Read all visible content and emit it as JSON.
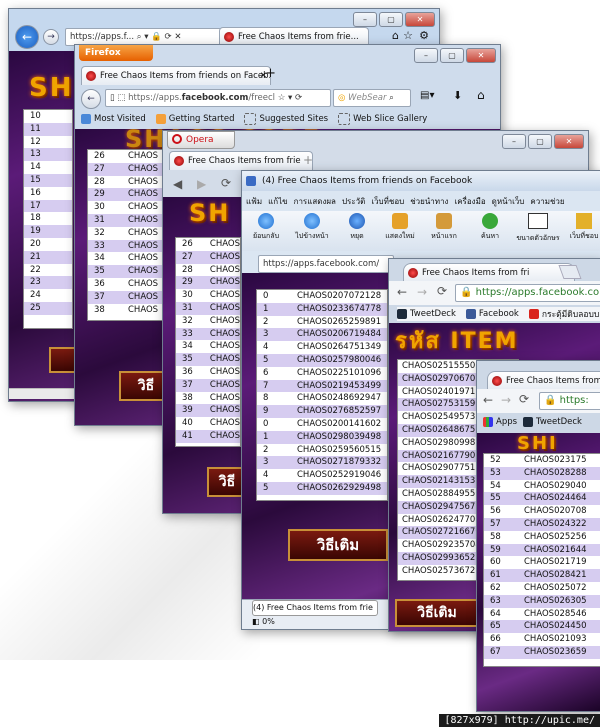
{
  "colors": {
    "row_alt": "#d6ccf0",
    "banner": "#f0a400",
    "ie_blue": "#1c6fd1",
    "firefox_orange": "#e66000",
    "opera_red": "#cc0f16"
  },
  "ie": {
    "url": "https://apps.f...",
    "tab_title": "Free Chaos Items from frie...",
    "rows": [
      [
        "10",
        ""
      ],
      [
        "11",
        ""
      ],
      [
        "12",
        ""
      ],
      [
        "13",
        ""
      ],
      [
        "14",
        ""
      ],
      [
        "15",
        ""
      ],
      [
        "16",
        ""
      ],
      [
        "17",
        ""
      ],
      [
        "18",
        ""
      ],
      [
        "19",
        ""
      ],
      [
        "20",
        ""
      ],
      [
        "21",
        ""
      ],
      [
        "22",
        ""
      ],
      [
        "23",
        ""
      ],
      [
        "24",
        ""
      ],
      [
        "25",
        ""
      ]
    ]
  },
  "firefox": {
    "app_button": "Firefox",
    "tab_title": "Free Chaos Items from friends on Faceb...",
    "new_tab": "+",
    "url_prefix": "https://apps.",
    "url_domain": "facebook.com",
    "url_suffix": "/freecl",
    "search_placeholder": "WebSear",
    "bookmarks": [
      "Most Visited",
      "Getting Started",
      "Suggested Sites",
      "Web Slice Gallery"
    ],
    "rows": [
      [
        "26",
        "CHAOS"
      ],
      [
        "27",
        "CHAOS"
      ],
      [
        "28",
        "CHAOS"
      ],
      [
        "29",
        "CHAOS"
      ],
      [
        "30",
        "CHAOS"
      ],
      [
        "31",
        "CHAOS"
      ],
      [
        "32",
        "CHAOS"
      ],
      [
        "33",
        "CHAOS"
      ],
      [
        "34",
        "CHAOS"
      ],
      [
        "35",
        "CHAOS"
      ],
      [
        "36",
        "CHAOS"
      ],
      [
        "37",
        "CHAOS"
      ],
      [
        "38",
        "CHAOS"
      ]
    ],
    "button": "วิธี"
  },
  "opera": {
    "app_button": "Opera",
    "tab_title": "Free Chaos Items from frie",
    "rows": [
      [
        "26",
        "CHAOS"
      ],
      [
        "27",
        "CHAOS"
      ],
      [
        "28",
        "CHAOS"
      ],
      [
        "29",
        "CHAOS"
      ],
      [
        "30",
        "CHAOS"
      ],
      [
        "31",
        "CHAOS"
      ],
      [
        "32",
        "CHAOS"
      ],
      [
        "33",
        "CHAOS"
      ],
      [
        "34",
        "CHAOS"
      ],
      [
        "35",
        "CHAOS"
      ],
      [
        "36",
        "CHAOS"
      ],
      [
        "37",
        "CHAOS"
      ],
      [
        "38",
        "CHAOS"
      ],
      [
        "39",
        "CHAOS"
      ],
      [
        "40",
        "CHAOS"
      ],
      [
        "41",
        "CHAOS"
      ]
    ],
    "button": "วิธี"
  },
  "thai": {
    "title": "(4) Free Chaos Items from friends on Facebook",
    "menu": [
      "แฟ้ม",
      "แก้ไข",
      "การแสดงผล",
      "ประวัติ",
      "เว็บที่ชอบ",
      "ช่วยนำทาง",
      "เครื่องมือ",
      "ดูหน้าเว็บ",
      "ความช่วย"
    ],
    "toolbar": [
      "ย้อนกลับ",
      "ไปข้างหน้า",
      "หยุด",
      "แสดงใหม่",
      "หน้าแรก",
      "ค้นหา",
      "ขนาดตัวอักษร",
      "เว็บที่ชอบ"
    ],
    "url": "https://apps.facebook.com/",
    "rows": [
      [
        "0",
        "CHAOS0207072128"
      ],
      [
        "1",
        "CHAOS0233674778"
      ],
      [
        "2",
        "CHAOS0265259891"
      ],
      [
        "3",
        "CHAOS0206719484"
      ],
      [
        "4",
        "CHAOS0264751349"
      ],
      [
        "5",
        "CHAOS0257980046"
      ],
      [
        "6",
        "CHAOS0225101096"
      ],
      [
        "7",
        "CHAOS0219453499"
      ],
      [
        "8",
        "CHAOS0248692947"
      ],
      [
        "9",
        "CHAOS0276852597"
      ],
      [
        "0",
        "CHAOS0200141602"
      ],
      [
        "1",
        "CHAOS0298039498"
      ],
      [
        "2",
        "CHAOS0259560515"
      ],
      [
        "3",
        "CHAOS0271879332"
      ],
      [
        "4",
        "CHAOS0252919046"
      ],
      [
        "5",
        "CHAOS0262929498"
      ]
    ],
    "status_tab": "(4) Free Chaos Items from frie",
    "zoom": "0%",
    "button": "วิธีเติม"
  },
  "chrome1": {
    "tab_title": "Free Chaos Items from fri",
    "url": "https://apps.facebook.com",
    "bookmarks": [
      "TweetDeck",
      "Facebook",
      "กระตุ้มีดิบลอบบ »"
    ],
    "banner": "รหัส ITEM",
    "codes": [
      "CHAOS025155506",
      "CHAOS029706701",
      "CHAOS024019712",
      "CHAOS027531590",
      "CHAOS025495737",
      "CHAOS026486752",
      "CHAOS029809985",
      "CHAOS021677908",
      "CHAOS029077511",
      "CHAOS021431538",
      "CHAOS028849550",
      "CHAOS029475677",
      "CHAOS026247700",
      "CHAOS027216670",
      "CHAOS029235704",
      "CHAOS029936522",
      "CHAOS025736722"
    ],
    "button": "วิธีเติม"
  },
  "chrome2": {
    "tab_title": "Free Chaos Items from fri",
    "url": "https:",
    "bookmarks": [
      "Apps",
      "TweetDeck"
    ],
    "rows": [
      [
        "52",
        "CHAOS023175"
      ],
      [
        "53",
        "CHAOS028288"
      ],
      [
        "54",
        "CHAOS029040"
      ],
      [
        "55",
        "CHAOS024464"
      ],
      [
        "56",
        "CHAOS020708"
      ],
      [
        "57",
        "CHAOS024322"
      ],
      [
        "58",
        "CHAOS025256"
      ],
      [
        "59",
        "CHAOS021644"
      ],
      [
        "60",
        "CHAOS021719"
      ],
      [
        "61",
        "CHAOS028421"
      ],
      [
        "62",
        "CHAOS025072"
      ],
      [
        "63",
        "CHAOS026305"
      ],
      [
        "64",
        "CHAOS028546"
      ],
      [
        "65",
        "CHAOS024450"
      ],
      [
        "66",
        "CHAOS021093"
      ],
      [
        "67",
        "CHAOS023659"
      ]
    ]
  },
  "watermark": "[827x979] http://upic.me/"
}
